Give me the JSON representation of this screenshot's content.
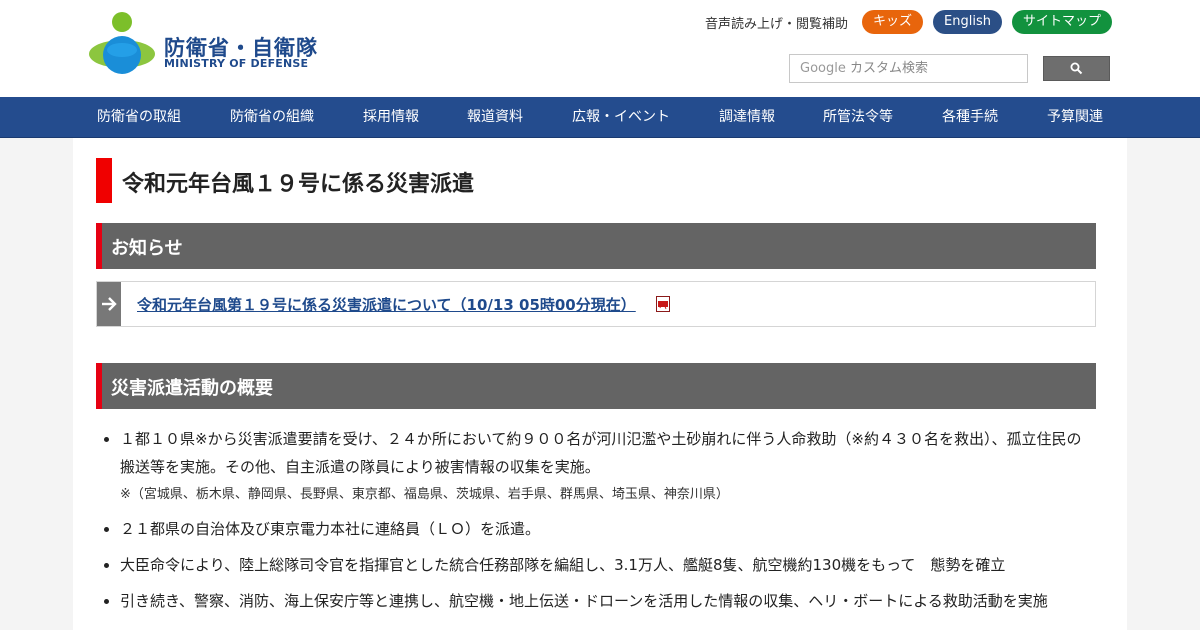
{
  "header": {
    "logo_jp": "防衛省・自衛隊",
    "logo_en": "MINISTRY OF DEFENSE",
    "voice_link": "音声読み上げ・閲覧補助",
    "kids_label": "キッズ",
    "english_label": "English",
    "sitemap_label": "サイトマップ",
    "search_brand": "Google",
    "search_placeholder": "カスタム検索",
    "colors": {
      "kids": "#e8650c",
      "english": "#2b4f86",
      "sitemap": "#12923e",
      "nav": "#244c8e"
    }
  },
  "nav": {
    "items": [
      {
        "label": "防衛省の取組"
      },
      {
        "label": "防衛省の組織"
      },
      {
        "label": "採用情報"
      },
      {
        "label": "報道資料"
      },
      {
        "label": "広報・イベント"
      },
      {
        "label": "調達情報"
      },
      {
        "label": "所管法令等"
      },
      {
        "label": "各種手続"
      },
      {
        "label": "予算関連"
      }
    ]
  },
  "main": {
    "page_title": "令和元年台風１９号に係る災害派遣",
    "notice_heading": "お知らせ",
    "notice_link": "令和元年台風第１９号に係る災害派遣について（10/13 05時00分現在）",
    "notice_icon": "pdf-icon",
    "overview_heading": "災害派遣活動の概要",
    "overview_items": [
      {
        "text": "１都１０県※から災害派遣要請を受け、２４か所において約９００名が河川氾濫や土砂崩れに伴う人命救助（※約４３０名を救出）、孤立住民の搬送等を実施。その他、自主派遣の隊員により被害情報の収集を実施。",
        "note": "※（宮城県、栃木県、静岡県、長野県、東京都、福島県、茨城県、岩手県、群馬県、埼玉県、神奈川県）"
      },
      {
        "text": "２１都県の自治体及び東京電力本社に連絡員（ＬＯ）を派遣。"
      },
      {
        "text": "大臣命令により、陸上総隊司令官を指揮官とした統合任務部隊を編組し、3.1万人、艦艇8隻、航空機約130機をもって　態勢を確立"
      },
      {
        "text": "引き続き、警察、消防、海上保安庁等と連携し、航空機・地上伝送・ドローンを活用した情報の収集、ヘリ・ボートによる救助活動を実施"
      }
    ]
  }
}
